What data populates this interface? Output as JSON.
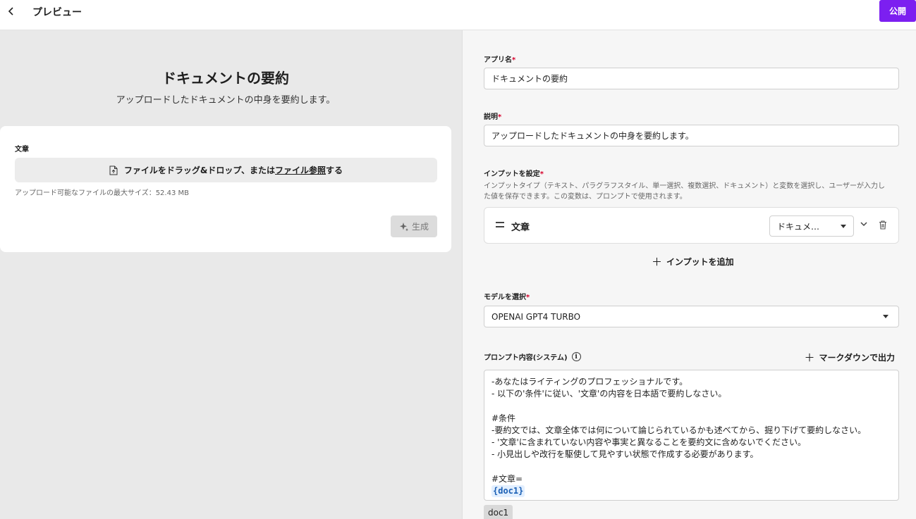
{
  "header": {
    "title": "プレビュー",
    "publish_label": "公開"
  },
  "preview": {
    "app_title": "ドキュメントの要約",
    "app_description": "アップロードしたドキュメントの中身を要約します。",
    "field_label": "文章",
    "dropzone": {
      "text_before": "ファイルをドラッグ&ドロップ、または",
      "link_text": "ファイル参照",
      "text_after": "する"
    },
    "max_size_note": "アップロード可能なファイルの最大サイズ：52.43 MB",
    "generate_label": "生成"
  },
  "settings": {
    "app_name": {
      "label": "アプリ名",
      "value": "ドキュメントの要約"
    },
    "description": {
      "label": "説明",
      "value": "アップロードしたドキュメントの中身を要約します。"
    },
    "inputs": {
      "label": "インプットを設定",
      "help_lines": [
        "インプットタイプ（テキスト、パラグラフスタイル、単一選択、複数選択、ドキュメント）と変数を選択し、ユーザーが入力し",
        "た値を保存できます。この変数は、プロンプトで使用されます。"
      ],
      "items": [
        {
          "name": "文章",
          "type": "ドキュメ…"
        }
      ],
      "add_label": "インプットを追加"
    },
    "model": {
      "label": "モデルを選択",
      "value": "OPENAI GPT4 TURBO"
    },
    "prompt": {
      "label": "プロンプト内容(システム)",
      "markdown_label": "マークダウンで出力",
      "lines": [
        "-あなたはライティングのプロフェッショナルです。",
        "- 以下の'条件'に従い、'文章'の内容を日本語で要約しなさい。",
        "",
        "#条件",
        "-要約文では、文章全体では何について論じられているかも述べてから、掘り下げて要約しなさい。",
        "- '文章'に含まれていない内容や事実と異なることを要約文に含めないでください。",
        "- 小見出しや改行を駆使して見やすい状態で作成する必要があります。",
        "",
        "#文章="
      ],
      "variable": "{doc1}"
    },
    "variable_chip": "doc1"
  },
  "colors": {
    "accent": "#7c1ff0",
    "required": "#d6002b",
    "variable_bg": "#e2efff",
    "variable_text": "#1a5fb4"
  }
}
